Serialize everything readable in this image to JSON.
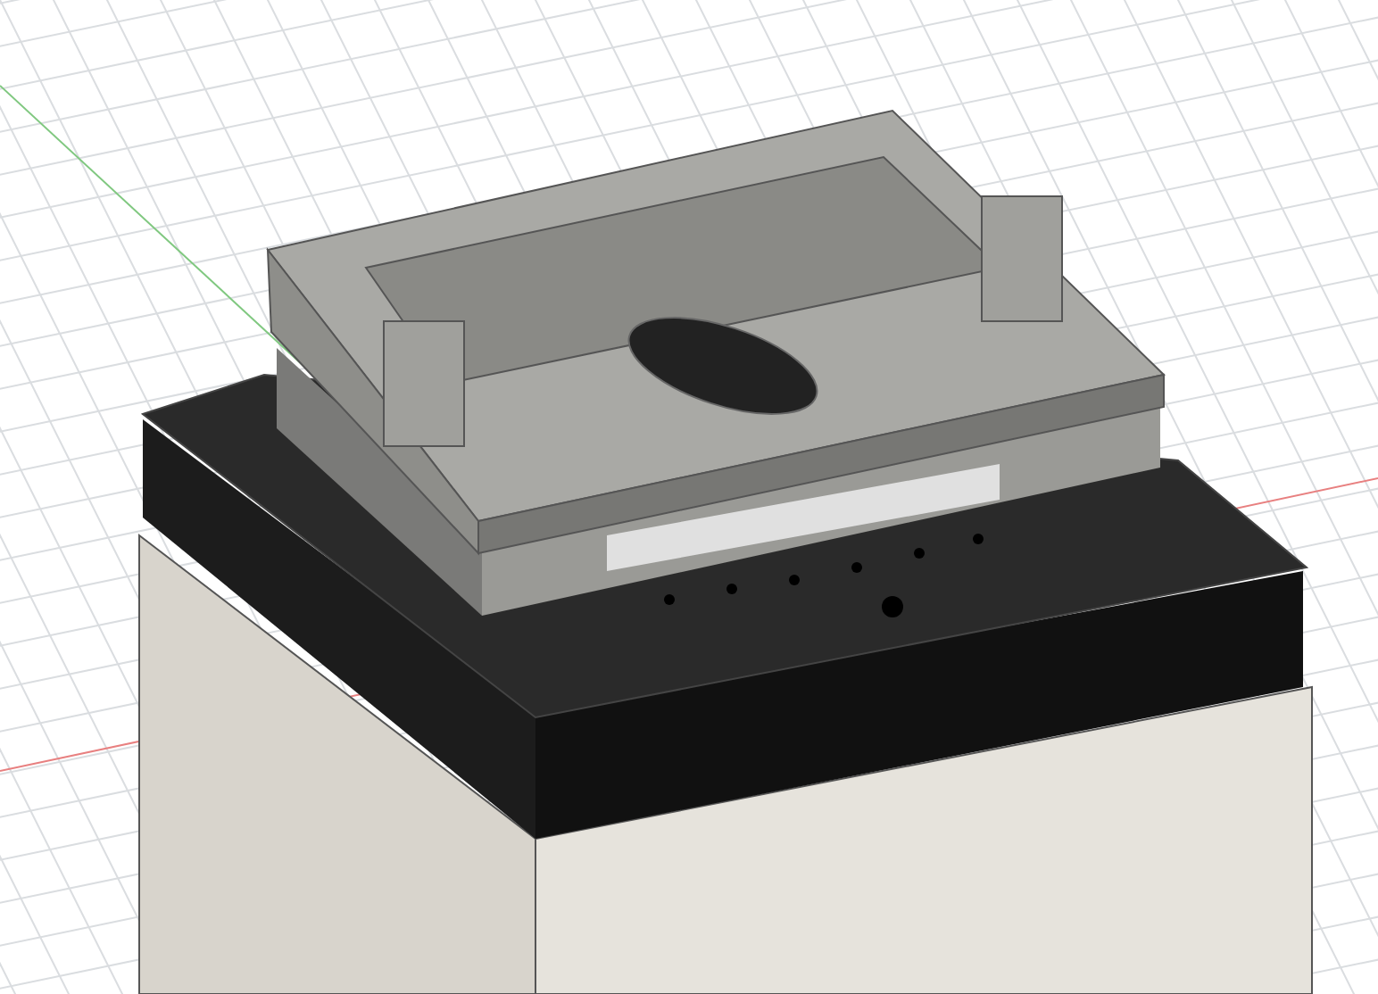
{
  "viewport": {
    "kind": "cad-3d",
    "grid": true
  }
}
